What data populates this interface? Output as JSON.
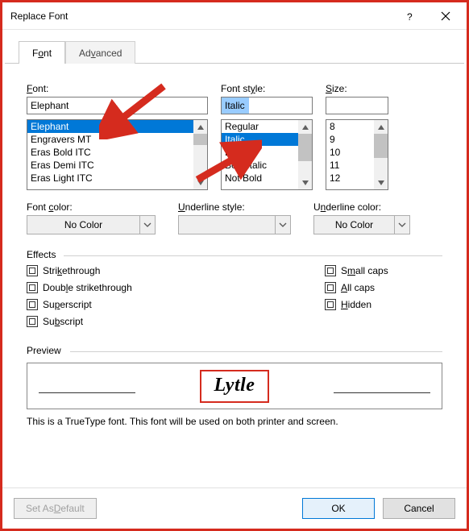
{
  "titlebar": {
    "title": "Replace Font"
  },
  "tabs": {
    "font": "Font",
    "advanced": "Advanced",
    "font_ul": "o",
    "adv_ul": "v"
  },
  "labels": {
    "font": "Font:",
    "font_ul": "F",
    "style": "Font style:",
    "style_ul": "y",
    "size": "Size:",
    "size_ul": "S",
    "font_color": "Font color:",
    "font_color_ul": "c",
    "underline_style": "Underline style:",
    "underline_style_ul": "U",
    "underline_color": "Underline color:",
    "underline_color_ul": "n",
    "effects": "Effects",
    "preview": "Preview"
  },
  "font": {
    "value": "Elephant",
    "items": [
      "Elephant",
      "Engravers MT",
      "Eras Bold ITC",
      "Eras Demi ITC",
      "Eras Light ITC"
    ],
    "selected": "Elephant"
  },
  "style": {
    "value": "Italic",
    "items": [
      "Regular",
      "Italic",
      "Bold",
      "Bold Italic",
      "Not Bold"
    ],
    "selected": "Italic"
  },
  "size": {
    "value": "",
    "items": [
      "8",
      "9",
      "10",
      "11",
      "12"
    ]
  },
  "combos": {
    "font_color": "No Color",
    "underline_style": "",
    "underline_color": "No Color"
  },
  "effects": {
    "strikethrough": "Strikethrough",
    "strikethrough_ul": "k",
    "double_strikethrough": "Double strikethrough",
    "double_ul": "l",
    "superscript": "Superscript",
    "sup_ul": "p",
    "subscript": "Subscript",
    "sub_ul": "b",
    "small_caps": "Small caps",
    "small_ul": "m",
    "all_caps": "All caps",
    "all_ul": "A",
    "hidden": "Hidden",
    "hidden_ul": "H"
  },
  "preview": {
    "text": "Lytle"
  },
  "footnote": "This is a TrueType font. This font will be used on both printer and screen.",
  "buttons": {
    "set_default": "Set As Default",
    "set_default_ul": "D",
    "ok": "OK",
    "cancel": "Cancel"
  }
}
